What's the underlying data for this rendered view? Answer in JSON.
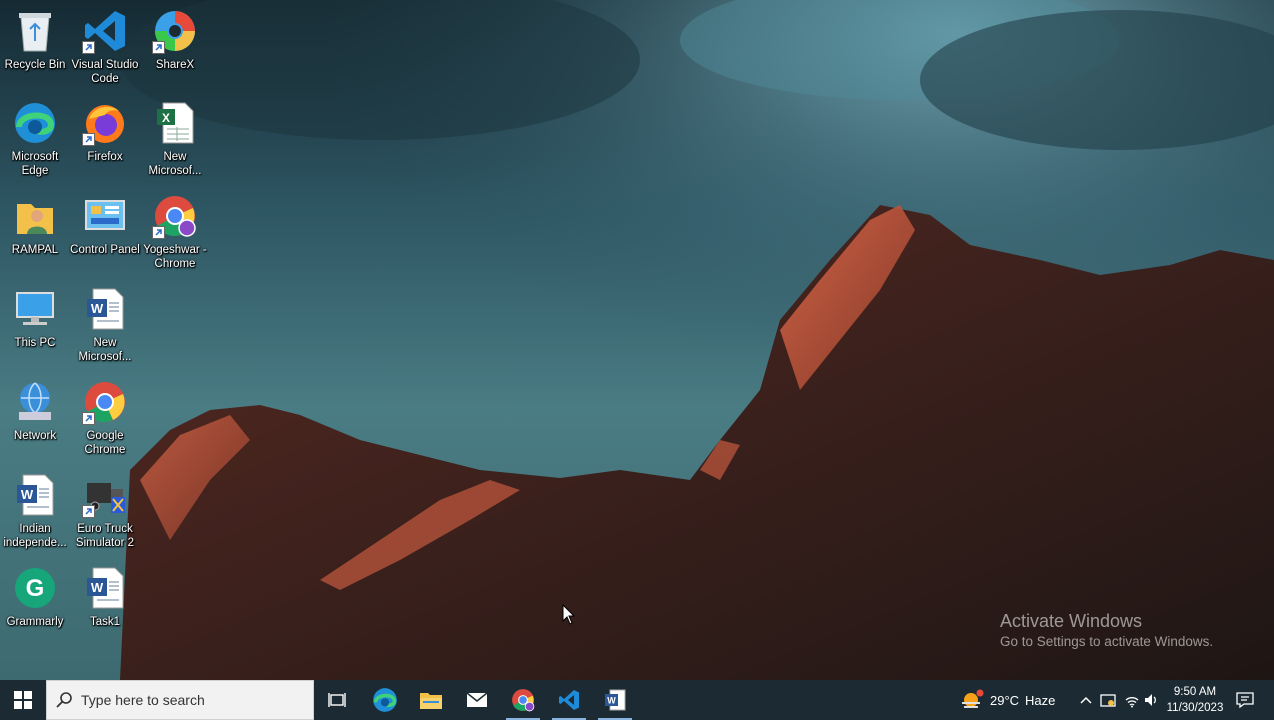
{
  "desktop_icons": [
    {
      "label": "Recycle Bin",
      "icon": "recycle-bin-icon",
      "shortcut": false
    },
    {
      "label": "Visual Studio Code",
      "icon": "vscode-icon",
      "shortcut": true
    },
    {
      "label": "ShareX",
      "icon": "sharex-icon",
      "shortcut": true
    },
    {
      "label": "Microsoft Edge",
      "icon": "edge-icon",
      "shortcut": false
    },
    {
      "label": "Firefox",
      "icon": "firefox-icon",
      "shortcut": true
    },
    {
      "label": "New Microsof...",
      "icon": "excel-file-icon",
      "shortcut": false
    },
    {
      "label": "RAMPAL",
      "icon": "user-folder-icon",
      "shortcut": false
    },
    {
      "label": "Control Panel",
      "icon": "control-panel-icon",
      "shortcut": false
    },
    {
      "label": "Yogeshwar - Chrome",
      "icon": "chrome-profile-icon",
      "shortcut": true
    },
    {
      "label": "This PC",
      "icon": "this-pc-icon",
      "shortcut": false
    },
    {
      "label": "New Microsof...",
      "icon": "word-file-icon",
      "shortcut": false
    },
    {
      "label": "Network",
      "icon": "network-icon",
      "shortcut": false
    },
    {
      "label": "Google Chrome",
      "icon": "chrome-icon",
      "shortcut": true
    },
    {
      "label": "Indian independe...",
      "icon": "word-file-icon",
      "shortcut": false
    },
    {
      "label": "Euro Truck Simulator 2",
      "icon": "euro-truck-icon",
      "shortcut": true
    },
    {
      "label": "Grammarly",
      "icon": "grammarly-icon",
      "shortcut": false
    },
    {
      "label": "Task1",
      "icon": "word-file-icon",
      "shortcut": false
    }
  ],
  "watermark": {
    "title": "Activate Windows",
    "subtitle": "Go to Settings to activate Windows."
  },
  "taskbar": {
    "search_placeholder": "Type here to search",
    "pinned": [
      "start-icon",
      "task-view-icon",
      "edge-icon",
      "file-explorer-icon",
      "mail-icon",
      "chrome-icon",
      "vscode-icon",
      "word-icon"
    ],
    "weather": {
      "temp": "29°C",
      "condition": "Haze"
    },
    "clock": {
      "time": "9:50 AM",
      "date": "11/30/2023"
    }
  },
  "colors": {
    "taskbar_bg": "#1c2b33",
    "accent": "#8ab4e0"
  }
}
